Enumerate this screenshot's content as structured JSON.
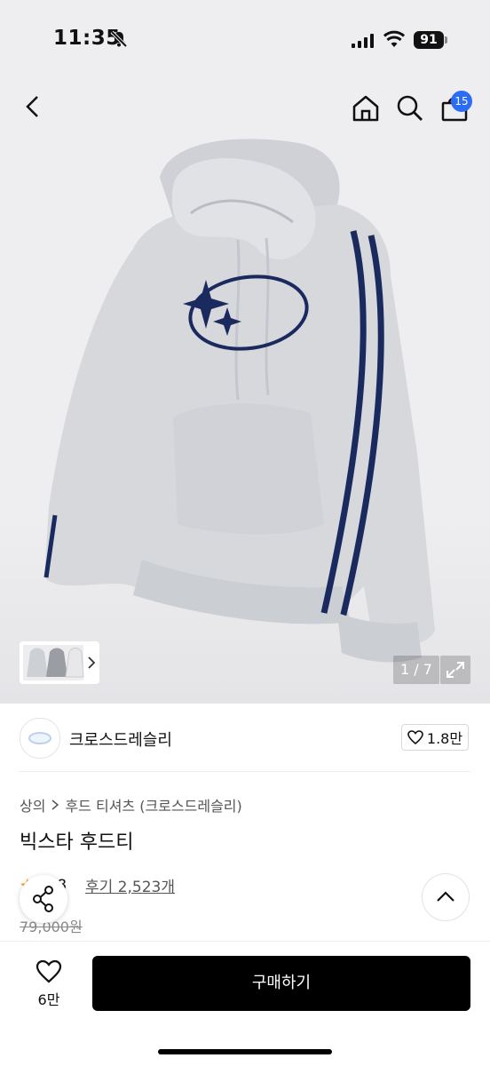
{
  "status": {
    "time": "11:35",
    "battery": "91"
  },
  "nav": {
    "cart_count": "15"
  },
  "gallery": {
    "counter": "1 / 7"
  },
  "brand": {
    "name": "크로스드레슬리",
    "likes": "1.8만"
  },
  "breadcrumb": {
    "category": "상의",
    "subcategory": "후드 티셔츠 (크로스드레슬리)"
  },
  "product": {
    "title": "빅스타 후드티",
    "rating_fragment": "4.8",
    "reviews": "후기 2,523개",
    "price": "79,000원"
  },
  "bottom": {
    "wish_count": "6만",
    "buy_label": "구매하기"
  },
  "colors": {
    "accent": "#2b6cf5",
    "hoodie": "#d6d8dc",
    "stripe": "#1b2a5e"
  }
}
